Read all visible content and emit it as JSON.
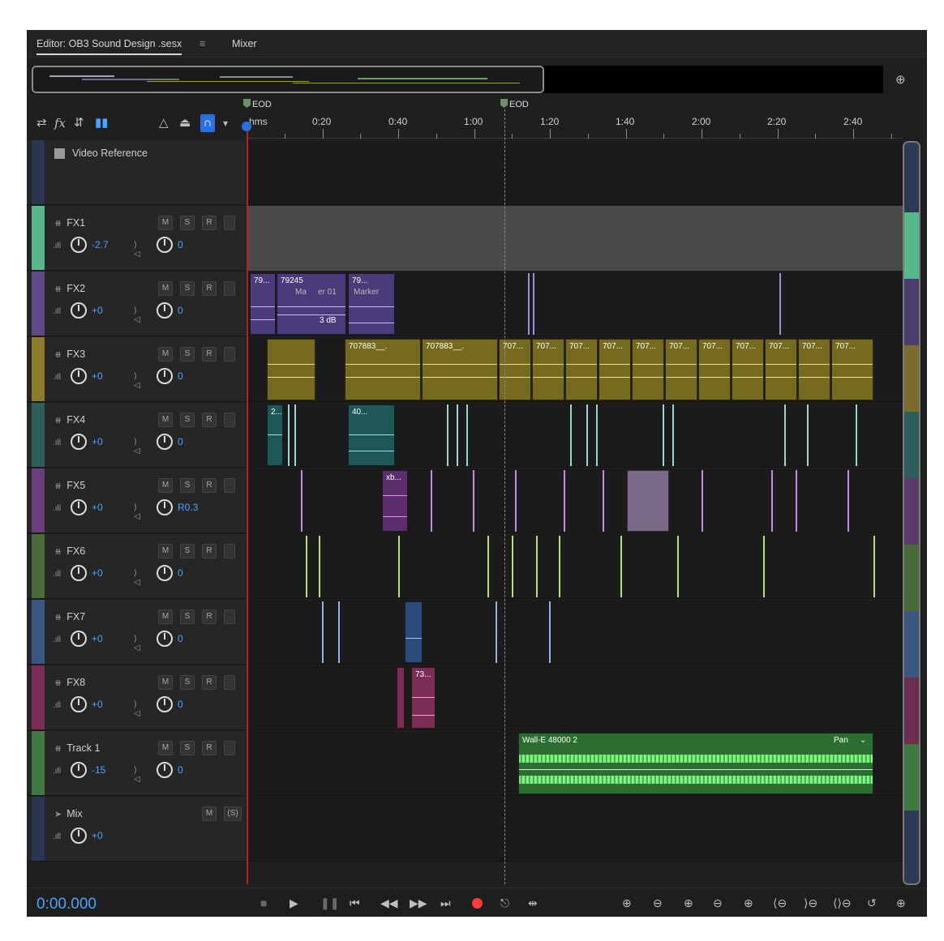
{
  "tabs": {
    "editor": "Editor: OB3 Sound Design .sesx",
    "menu_icon": "hamburger-icon",
    "mixer": "Mixer"
  },
  "markers": [
    {
      "label": "EOD"
    },
    {
      "label": "EOD"
    }
  ],
  "ruler": {
    "ticks": [
      "hms",
      "0:20",
      "0:40",
      "1:00",
      "1:20",
      "1:40",
      "2:00",
      "2:20",
      "2:40"
    ]
  },
  "video_reference": {
    "label": "Video Reference"
  },
  "buttons": {
    "mute": "M",
    "solo": "S",
    "record": "R",
    "solo_paren": "(S)"
  },
  "tracks": [
    {
      "name": "FX1",
      "volume": "-2.7",
      "pan": "0",
      "color": "#57b88b"
    },
    {
      "name": "FX2",
      "volume": "+0",
      "pan": "0",
      "color": "#5e4a88"
    },
    {
      "name": "FX3",
      "volume": "+0",
      "pan": "0",
      "color": "#8a7a2a"
    },
    {
      "name": "FX4",
      "volume": "+0",
      "pan": "0",
      "color": "#2f5d5a"
    },
    {
      "name": "FX5",
      "volume": "+0",
      "pan": "R0.3",
      "color": "#6a3e78"
    },
    {
      "name": "FX6",
      "volume": "+0",
      "pan": "0",
      "color": "#4b6a3a"
    },
    {
      "name": "FX7",
      "volume": "+0",
      "pan": "0",
      "color": "#3b5680"
    },
    {
      "name": "FX8",
      "volume": "+0",
      "pan": "0",
      "color": "#7a2e56"
    },
    {
      "name": "Track 1",
      "volume": "-15",
      "pan": "0",
      "color": "#3f7a44"
    }
  ],
  "mix": {
    "name": "Mix",
    "volume": "+0"
  },
  "clips": {
    "fx2": [
      "79...",
      "79245",
      "er 01",
      "Marker",
      "79...",
      "Ma",
      "3 dB"
    ],
    "fx3": [
      "707883__.",
      "707883__.",
      "707...",
      "707...",
      "707...",
      "707...",
      "707...",
      "707...",
      "707...",
      "707...",
      "707...",
      "707...",
      "707..."
    ],
    "fx4": [
      "2...",
      "40..."
    ],
    "fx5": [
      "xb..."
    ],
    "fx8": [
      "73..."
    ],
    "track1": {
      "name": "Wall-E 48000 2",
      "effect": "Pan"
    }
  },
  "transport": {
    "timecode": "0:00.000"
  },
  "colors": {
    "accent_blue": "#4aa3ff",
    "record_red": "#ff3b3b",
    "playhead": "#b02323"
  }
}
